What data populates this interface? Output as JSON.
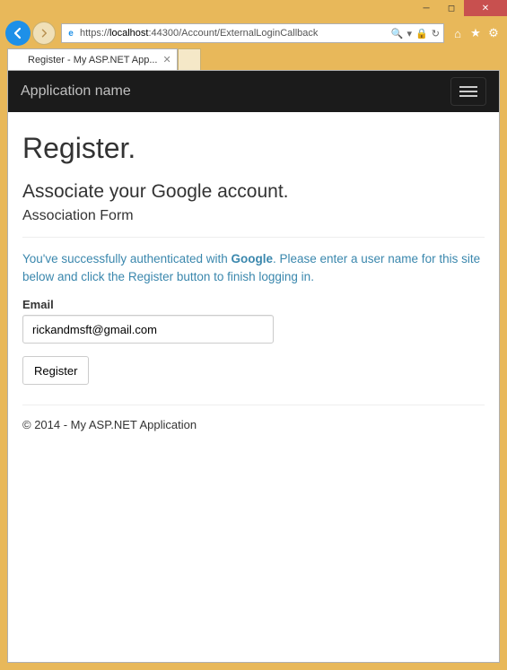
{
  "window": {
    "tab_title": "Register - My ASP.NET App..."
  },
  "address": {
    "scheme": "https://",
    "host": "localhost",
    "port_path": ":44300/Account/ExternalLoginCallback",
    "search_glyph": "🔍"
  },
  "navbar": {
    "brand": "Application name"
  },
  "page": {
    "title": "Register.",
    "subtitle": "Associate your Google account.",
    "form_heading": "Association Form",
    "info_pre": "You've successfully authenticated with ",
    "info_provider": "Google",
    "info_post": ". Please enter a user name for this site below and click the Register button to finish logging in.",
    "email_label": "Email",
    "email_value": "rickandmsft@gmail.com",
    "register_label": "Register"
  },
  "footer": {
    "text": "© 2014 - My ASP.NET Application"
  }
}
